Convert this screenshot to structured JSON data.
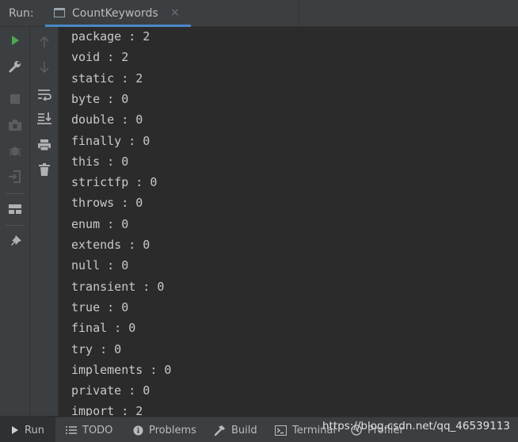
{
  "header": {
    "run_label": "Run:",
    "tab_title": "CountKeywords",
    "tab_close": "×"
  },
  "console_lines": [
    "package : 2",
    "void : 2",
    "static : 2",
    "byte : 0",
    "double : 0",
    "finally : 0",
    "this : 0",
    "strictfp : 0",
    "throws : 0",
    "enum : 0",
    "extends : 0",
    "null : 0",
    "transient : 0",
    "true : 0",
    "final : 0",
    "try : 0",
    "implements : 0",
    "private : 0",
    "import : 2"
  ],
  "bottom_tabs": {
    "run": "Run",
    "todo": "TODO",
    "problems": "Problems",
    "build": "Build",
    "terminal": "Terminal",
    "profiler": "Profiler"
  },
  "watermark": "https://blog.csdn.net/qq_46539113",
  "icons": {
    "rerun": "play-icon",
    "settings": "wrench-icon",
    "stop": "stop-icon",
    "snapshot": "camera-icon",
    "debug": "bug-icon",
    "exit": "exit-icon",
    "layout": "layout-icon",
    "pin": "pin-icon",
    "up": "arrow-up-icon",
    "down": "arrow-down-icon",
    "wrap": "soft-wrap-icon",
    "scroll_end": "scroll-to-end-icon",
    "print": "print-icon",
    "clear": "trash-icon"
  },
  "colors": {
    "accent": "#4a88c7",
    "run_green": "#4fa84f",
    "background": "#2b2b2b",
    "panel": "#3c3f41"
  }
}
